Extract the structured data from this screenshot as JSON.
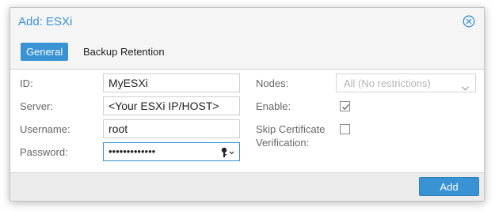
{
  "dialog": {
    "title": "Add: ESXi",
    "close_icon": "close-circle-icon"
  },
  "tabs": [
    {
      "label": "General",
      "active": true
    },
    {
      "label": "Backup Retention",
      "active": false
    }
  ],
  "form": {
    "id_label": "ID:",
    "id_value": "MyESXi",
    "server_label": "Server:",
    "server_value": "<Your ESXi IP/HOST>",
    "username_label": "Username:",
    "username_value": "root",
    "password_label": "Password:",
    "password_value": "•••••••••••••",
    "password_toggle_icon": "key-reveal-icon",
    "nodes_label": "Nodes:",
    "nodes_value": "All (No restrictions)",
    "enable_label": "Enable:",
    "enable_checked": true,
    "skip_cert_label_line1": "Skip Certificate",
    "skip_cert_label_line2": "Verification:",
    "skip_cert_checked": false
  },
  "footer": {
    "add_label": "Add"
  },
  "colors": {
    "accent": "#3892d3",
    "footer_bg": "#ececec"
  }
}
